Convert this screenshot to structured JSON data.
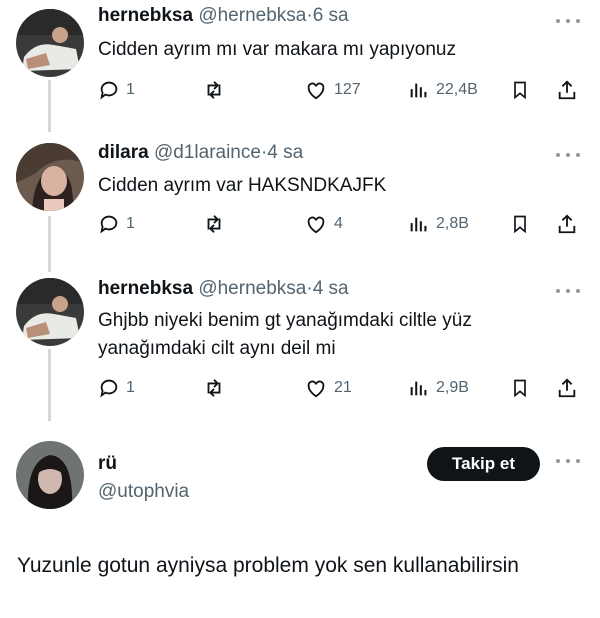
{
  "tweets": [
    {
      "name": "hernebksa",
      "handle": "@hernebksa",
      "dot": "·",
      "time": "6 sa",
      "text": "Cidden ayrım mı var makara mı yapıyonuz",
      "stats": {
        "replies": "1",
        "likes": "127",
        "views": "22,4B"
      }
    },
    {
      "name": "dilara",
      "handle": "@d1laraince",
      "dot": "·",
      "time": "4 sa",
      "text": "Cidden ayrım var HAKSNDKAJFK",
      "stats": {
        "replies": "1",
        "likes": "4",
        "views": "2,8B"
      }
    },
    {
      "name": "hernebksa",
      "handle": "@hernebksa",
      "dot": "·",
      "time": "4 sa",
      "text": "Ghjbb niyeki benim gt yanağımdaki ciltle yüz yanağımdaki cilt aynı deil mi",
      "stats": {
        "replies": "1",
        "likes": "21",
        "views": "2,9B"
      }
    }
  ],
  "focused": {
    "name": "rü",
    "handle": "@utophvia",
    "follow_label": "Takip et",
    "text": "Yuzunle gotun ayniysa problem yok sen kullanabilirsin"
  },
  "icons": {
    "reply": "reply-icon",
    "retweet": "retweet-icon",
    "like": "heart-icon",
    "views": "views-icon",
    "bookmark": "bookmark-icon",
    "share": "share-icon",
    "more": "more-icon"
  },
  "colors": {
    "text": "#0f1419",
    "secondary": "#536471",
    "thread_line": "#cfd9de",
    "button_bg": "#0f1419",
    "button_text": "#ffffff"
  }
}
